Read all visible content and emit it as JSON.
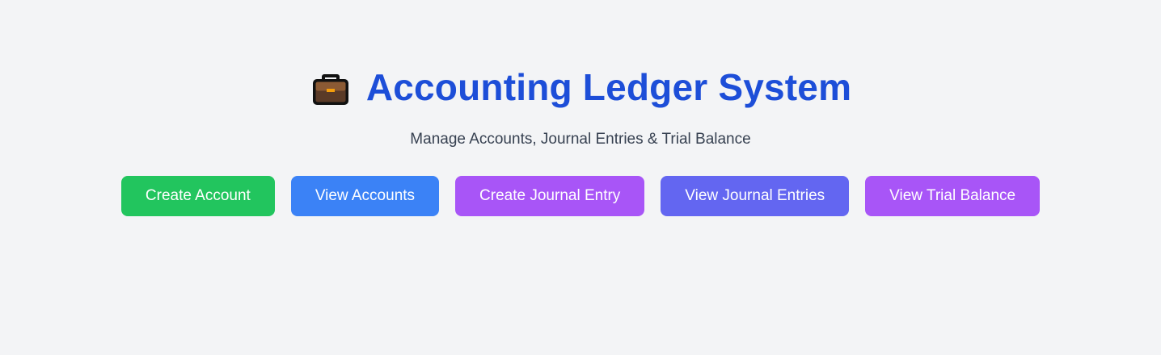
{
  "header": {
    "title": "Accounting Ledger System",
    "subtitle": "Manage Accounts, Journal Entries & Trial Balance",
    "icon": "briefcase-icon"
  },
  "actions": [
    {
      "label": "Create Account",
      "color": "#22c55e"
    },
    {
      "label": "View Accounts",
      "color": "#3b82f6"
    },
    {
      "label": "Create Journal Entry",
      "color": "#a855f7"
    },
    {
      "label": "View Journal Entries",
      "color": "#6366f1"
    },
    {
      "label": "View Trial Balance",
      "color": "#a855f7"
    }
  ],
  "colors": {
    "background": "#f3f4f6",
    "title": "#1d4ed8",
    "subtitle": "#374151"
  }
}
